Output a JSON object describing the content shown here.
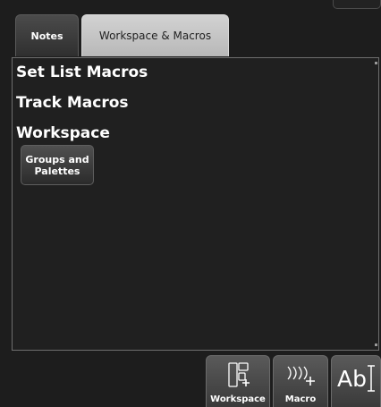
{
  "tabs": [
    {
      "label": "Notes",
      "active": false
    },
    {
      "label": "Workspace & Macros",
      "active": true
    }
  ],
  "panel": {
    "sections": [
      {
        "label": "Set List Macros"
      },
      {
        "label": "Track Macros"
      },
      {
        "label": "Workspace"
      }
    ],
    "workspace_buttons": [
      {
        "line1": "Groups and",
        "line2": "Palettes"
      }
    ]
  },
  "toolbar": {
    "buttons": [
      {
        "label": "Workspace",
        "icon": "workspace-add-icon"
      },
      {
        "label": "Macro",
        "icon": "macro-add-icon"
      },
      {
        "label": "",
        "icon": "text-cursor-icon"
      }
    ],
    "text_icon_glyph": "Ab"
  },
  "colors": {
    "background": "#1d1d1d",
    "active_tab": "#c4c4c4",
    "inactive_tab": "#3c3c3c",
    "text": "#ffffff"
  }
}
